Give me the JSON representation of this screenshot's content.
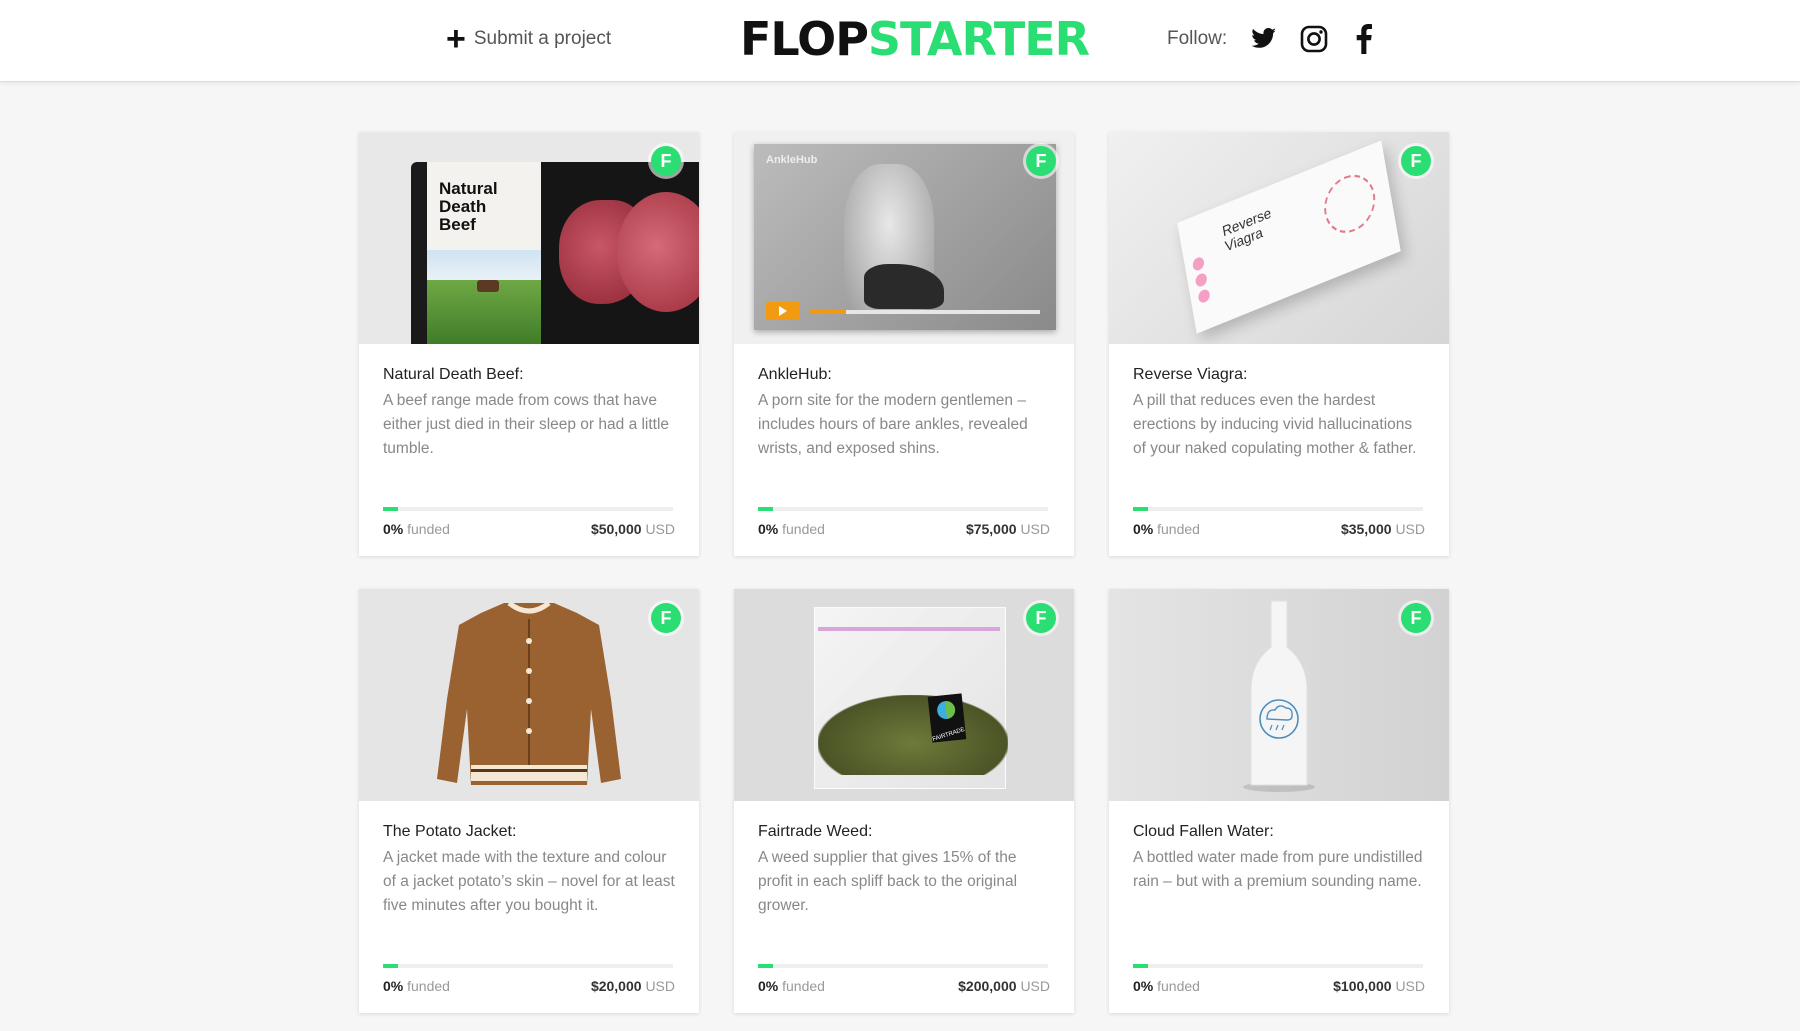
{
  "header": {
    "submit_label": "Submit a project",
    "logo_part1": "FLOP",
    "logo_part2": "STARTER",
    "follow_label": "Follow:",
    "social_icons": [
      "twitter-icon",
      "instagram-icon",
      "facebook-icon"
    ]
  },
  "colors": {
    "accent": "#2bde73",
    "background": "#f6f6f6"
  },
  "projects": [
    {
      "title": "Natural Death Beef:",
      "description": "A beef range made from cows that have either just died in their sleep or had a little tumble.",
      "image_text": "Natural Death Beef",
      "funded_pct": "0%",
      "funded_label": "funded",
      "goal": "$50,000",
      "currency": "USD",
      "progress": 0.05
    },
    {
      "title": "AnkleHub:",
      "description": "A porn site for the modern gentlemen – includes hours of bare ankles, revealed wrists, and exposed shins.",
      "image_text": "AnkleHub",
      "funded_pct": "0%",
      "funded_label": "funded",
      "goal": "$75,000",
      "currency": "USD",
      "progress": 0.05
    },
    {
      "title": "Reverse Viagra:",
      "description": "A pill that reduces even the hardest erections by inducing vivid hallucinations of your naked copulating mother & father.",
      "image_text": "Reverse Viagra",
      "funded_pct": "0%",
      "funded_label": "funded",
      "goal": "$35,000",
      "currency": "USD",
      "progress": 0.05
    },
    {
      "title": "The Potato Jacket:",
      "description": "A jacket made with the texture and colour of a jacket potato’s skin – novel for at least five minutes after you bought it.",
      "funded_pct": "0%",
      "funded_label": "funded",
      "goal": "$20,000",
      "currency": "USD",
      "progress": 0.05
    },
    {
      "title": "Fairtrade Weed:",
      "description": "A weed supplier that gives 15% of the profit in each spliff back to the original grower.",
      "image_text": "FAIRTRADE",
      "funded_pct": "0%",
      "funded_label": "funded",
      "goal": "$200,000",
      "currency": "USD",
      "progress": 0.05
    },
    {
      "title": "Cloud Fallen Water:",
      "description": "A bottled water made from pure undistilled rain – but with a premium sounding name.",
      "funded_pct": "0%",
      "funded_label": "funded",
      "goal": "$100,000",
      "currency": "USD",
      "progress": 0.05
    }
  ]
}
